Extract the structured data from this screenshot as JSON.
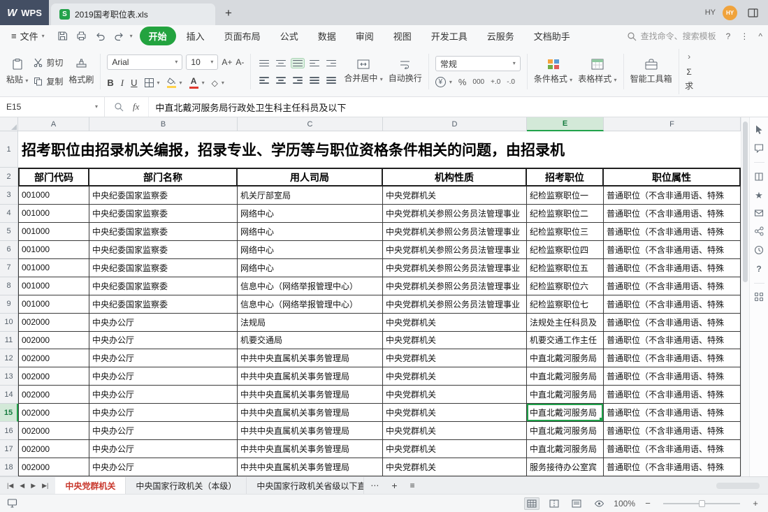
{
  "colors": {
    "accent_green": "#23a33f",
    "selection_green": "#21a24b",
    "active_sheet_red": "#c8372c",
    "avatar_orange": "#f0a33c",
    "wps_tab_navy": "#434e63",
    "doc_icon_green": "#23a24a"
  },
  "icons": {
    "caret_down": "▾",
    "hamburger": "≡",
    "ellipsis_h": "⋯",
    "plus": "+",
    "sheet_list": "≡",
    "nav_first": "|◀",
    "nav_prev": "◀",
    "nav_next": "▶",
    "nav_last": "▶|",
    "collapse_ribbon": "^",
    "more_vertical": "⋮",
    "chevron_right": "›",
    "sigma": "Σ",
    "diamond": "◇",
    "yuan": "¥",
    "star": "★",
    "question": "?",
    "minus": "−"
  },
  "titlebar": {
    "wps_label": "WPS",
    "wps_logo": "W",
    "doc_icon_letter": "S",
    "doc_tab_title": "2019国考职位表.xls",
    "new_tab": "+",
    "user_label": "HY",
    "avatar_initials": "HY"
  },
  "menubar": {
    "file_label": "文件",
    "tabs": [
      {
        "label": "开始",
        "active": true
      },
      {
        "label": "插入",
        "active": false
      },
      {
        "label": "页面布局",
        "active": false
      },
      {
        "label": "公式",
        "active": false
      },
      {
        "label": "数据",
        "active": false
      },
      {
        "label": "审阅",
        "active": false
      },
      {
        "label": "视图",
        "active": false
      },
      {
        "label": "开发工具",
        "active": false
      },
      {
        "label": "云服务",
        "active": false
      },
      {
        "label": "文档助手",
        "active": false
      }
    ],
    "search_placeholder": "查找命令、搜索模板",
    "help_label": "?"
  },
  "ribbon": {
    "paste_label": "粘贴",
    "cut_label": "剪切",
    "copy_label": "复制",
    "format_painter_label": "格式刷",
    "font_name": "Arial",
    "font_size": "10",
    "grow_font": "A+",
    "shrink_font": "A-",
    "bold": "B",
    "italic": "I",
    "underline": "U",
    "merge_center_label": "合并居中",
    "wrap_text_label": "自动换行",
    "number_format_value": "常规",
    "percent_label": "%",
    "thousands_label": "000",
    "inc_decimal_label": "+.0",
    "dec_decimal_label": "-.0",
    "conditional_format_label": "条件格式",
    "table_style_label": "表格样式",
    "smart_toolbox_label": "智能工具箱",
    "sum_label": "求"
  },
  "formula_bar": {
    "name_box": "E15",
    "fx_label": "fx",
    "content": "中直北戴河服务局行政处卫生科主任科员及以下"
  },
  "sheet": {
    "title_row_n": "1",
    "header_row_n": "2",
    "title_row_text": "招考职位由招录机关编报，招录专业、学历等与职位资格条件相关的问题，由招录机",
    "columns": [
      "A",
      "B",
      "C",
      "D",
      "E",
      "F"
    ],
    "selected_column": "E",
    "selected_row": 15,
    "active_cell": "E15",
    "header_row": [
      "部门代码",
      "部门名称",
      "用人司局",
      "机构性质",
      "招考职位",
      "职位属性"
    ],
    "rows": [
      {
        "n": 3,
        "cells": [
          "001000",
          "中央纪委国家监察委",
          "机关厅部室局",
          "中央党群机关",
          "纪检监察职位一",
          "普通职位（不含非通用语、特殊"
        ]
      },
      {
        "n": 4,
        "cells": [
          "001000",
          "中央纪委国家监察委",
          "网络中心",
          "中央党群机关参照公务员法管理事业",
          "纪检监察职位二",
          "普通职位（不含非通用语、特殊"
        ]
      },
      {
        "n": 5,
        "cells": [
          "001000",
          "中央纪委国家监察委",
          "网络中心",
          "中央党群机关参照公务员法管理事业",
          "纪检监察职位三",
          "普通职位（不含非通用语、特殊"
        ]
      },
      {
        "n": 6,
        "cells": [
          "001000",
          "中央纪委国家监察委",
          "网络中心",
          "中央党群机关参照公务员法管理事业",
          "纪检监察职位四",
          "普通职位（不含非通用语、特殊"
        ]
      },
      {
        "n": 7,
        "cells": [
          "001000",
          "中央纪委国家监察委",
          "网络中心",
          "中央党群机关参照公务员法管理事业",
          "纪检监察职位五",
          "普通职位（不含非通用语、特殊"
        ]
      },
      {
        "n": 8,
        "cells": [
          "001000",
          "中央纪委国家监察委",
          "信息中心（网络举报管理中心）",
          "中央党群机关参照公务员法管理事业",
          "纪检监察职位六",
          "普通职位（不含非通用语、特殊"
        ]
      },
      {
        "n": 9,
        "cells": [
          "001000",
          "中央纪委国家监察委",
          "信息中心（网络举报管理中心）",
          "中央党群机关参照公务员法管理事业",
          "纪检监察职位七",
          "普通职位（不含非通用语、特殊"
        ]
      },
      {
        "n": 10,
        "cells": [
          "002000",
          "中央办公厅",
          "法规局",
          "中央党群机关",
          "法规处主任科员及",
          "普通职位（不含非通用语、特殊"
        ]
      },
      {
        "n": 11,
        "cells": [
          "002000",
          "中央办公厅",
          "机要交通局",
          "中央党群机关",
          "机要交通工作主任",
          "普通职位（不含非通用语、特殊"
        ]
      },
      {
        "n": 12,
        "cells": [
          "002000",
          "中央办公厅",
          "中共中央直属机关事务管理局",
          "中央党群机关",
          "中直北戴河服务局",
          "普通职位（不含非通用语、特殊"
        ]
      },
      {
        "n": 13,
        "cells": [
          "002000",
          "中央办公厅",
          "中共中央直属机关事务管理局",
          "中央党群机关",
          "中直北戴河服务局",
          "普通职位（不含非通用语、特殊"
        ]
      },
      {
        "n": 14,
        "cells": [
          "002000",
          "中央办公厅",
          "中共中央直属机关事务管理局",
          "中央党群机关",
          "中直北戴河服务局",
          "普通职位（不含非通用语、特殊"
        ]
      },
      {
        "n": 15,
        "cells": [
          "002000",
          "中央办公厅",
          "中共中央直属机关事务管理局",
          "中央党群机关",
          "中直北戴河服务局",
          "普通职位（不含非通用语、特殊"
        ]
      },
      {
        "n": 16,
        "cells": [
          "002000",
          "中央办公厅",
          "中共中央直属机关事务管理局",
          "中央党群机关",
          "中直北戴河服务局",
          "普通职位（不含非通用语、特殊"
        ]
      },
      {
        "n": 17,
        "cells": [
          "002000",
          "中央办公厅",
          "中共中央直属机关事务管理局",
          "中央党群机关",
          "中直北戴河服务局",
          "普通职位（不含非通用语、特殊"
        ]
      },
      {
        "n": 18,
        "cells": [
          "002000",
          "中央办公厅",
          "中共中央直属机关事务管理局",
          "中央党群机关",
          "服务接待办公室宾",
          "普通职位（不含非通用语、特殊"
        ]
      }
    ]
  },
  "tabbar": {
    "sheets": [
      {
        "label": "中央党群机关",
        "active": true
      },
      {
        "label": "中央国家行政机关（本级）",
        "active": false
      },
      {
        "label": "中央国家行政机关省级以下直属",
        "active": false
      }
    ]
  },
  "statusbar": {
    "zoom_level": "100%"
  }
}
